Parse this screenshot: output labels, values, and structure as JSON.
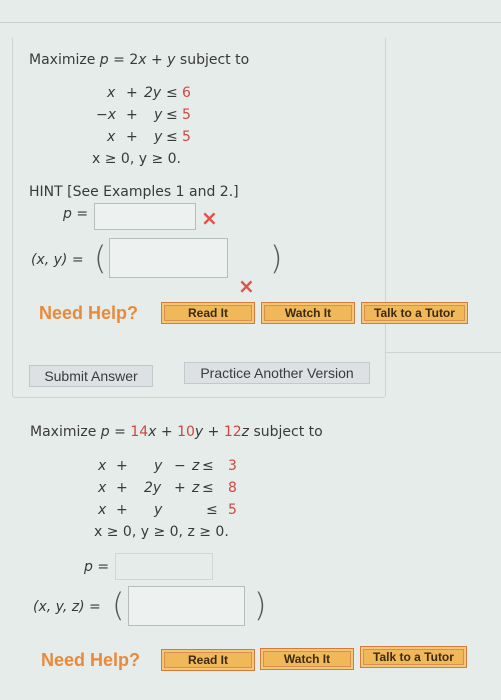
{
  "problem1": {
    "prefix": "Maximize ",
    "objective_var": "p",
    "eq": " = ",
    "coef_x": "2",
    "var_x": "x",
    "plus1": " + ",
    "var_y": "y",
    "suffix": " subject to",
    "constraints": [
      {
        "lhs_x": "x",
        "op1": "+",
        "lhs_y": "2y",
        "rel": "≤",
        "rhs": "6"
      },
      {
        "lhs_x": "−x",
        "op1": "+",
        "lhs_y": "y",
        "rel": "≤",
        "rhs": "5"
      },
      {
        "lhs_x": "x",
        "op1": "+",
        "lhs_y": "y",
        "rel": "≤",
        "rhs": "5"
      }
    ],
    "nonneg": "x ≥ 0, y ≥ 0.",
    "hint": "HINT [See Examples 1 and 2.]",
    "p_label": "p =",
    "p_value": "",
    "point_label": "(x, y) =",
    "point_value": "",
    "p_status": "incorrect",
    "point_status": "incorrect",
    "incorrect_icon": "×",
    "need_help": "Need Help?",
    "buttons": [
      "Read It",
      "Watch It",
      "Talk to a Tutor"
    ],
    "submit": "Submit Answer",
    "practice": "Practice Another Version"
  },
  "problem2": {
    "prefix": "Maximize ",
    "objective_var": "p",
    "eq": " = ",
    "terms": [
      {
        "coef": "14",
        "var": "x",
        "sep": " + "
      },
      {
        "coef": "10",
        "var": "y",
        "sep": " + "
      },
      {
        "coef": "12",
        "var": "z",
        "sep": ""
      }
    ],
    "suffix": " subject to",
    "constraints": [
      {
        "x": "x",
        "op1": "+",
        "y": "y",
        "op2": "−",
        "z": "z",
        "rel": "≤",
        "rhs": "3"
      },
      {
        "x": "x",
        "op1": "+",
        "y": "2y",
        "op2": "+",
        "z": "z",
        "rel": "≤",
        "rhs": "8"
      },
      {
        "x": "x",
        "op1": "+",
        "y": "y",
        "op2": "",
        "z": "",
        "rel": "≤",
        "rhs": "5"
      }
    ],
    "nonneg": "x ≥ 0, y ≥ 0, z ≥ 0.",
    "p_label": "p =",
    "p_value": "",
    "point_label": "(x, y, z) =",
    "point_value": "",
    "need_help": "Need Help?",
    "buttons": [
      "Read It",
      "Watch It",
      "Talk to a Tutor"
    ]
  },
  "paren_open": "(",
  "paren_close": ")"
}
